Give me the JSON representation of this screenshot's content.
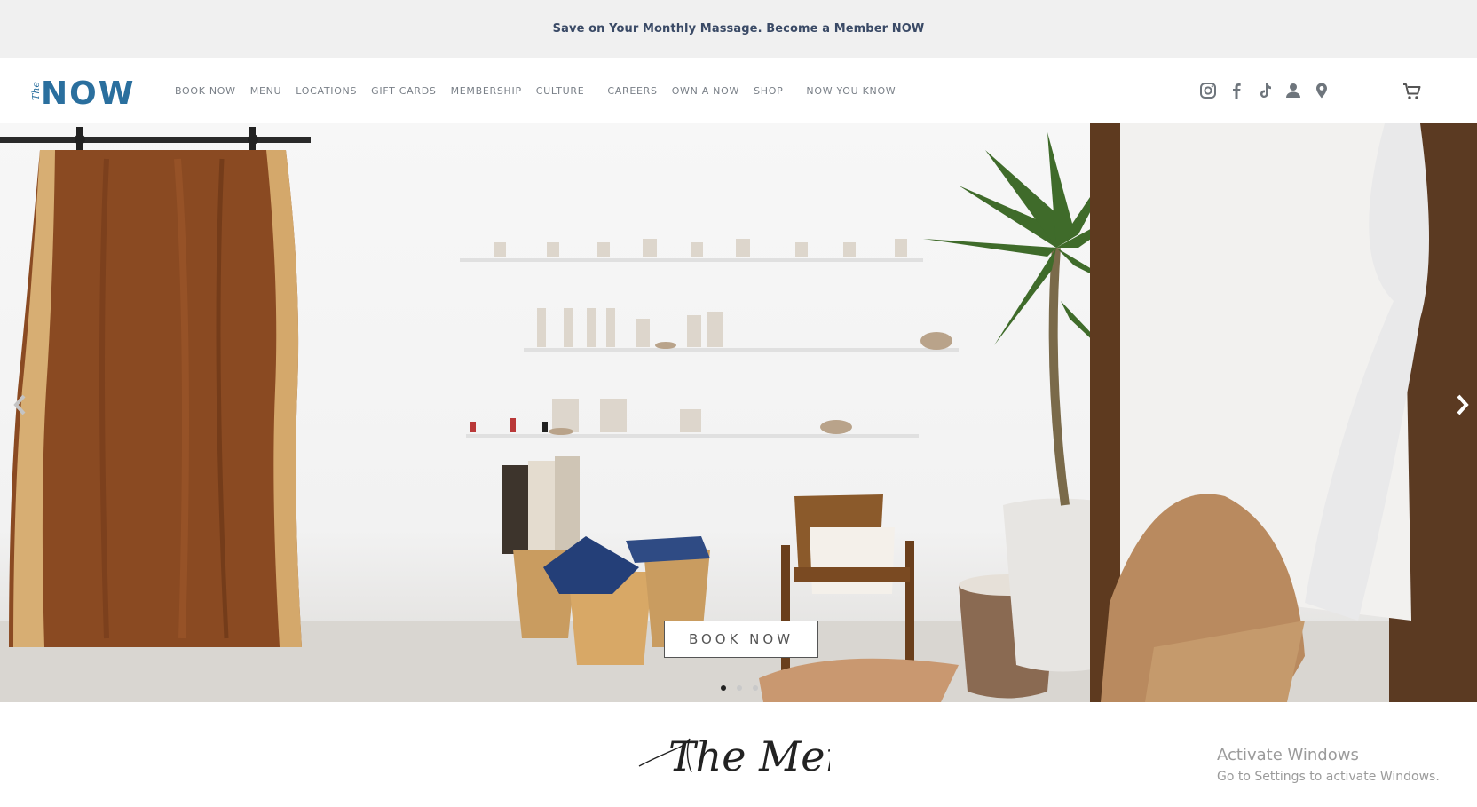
{
  "announcement": {
    "text": "Save on Your Monthly Massage. Become a Member NOW"
  },
  "header": {
    "logo_small": "The",
    "logo_big": "NOW",
    "nav": [
      {
        "label": "BOOK NOW"
      },
      {
        "label": "MENU"
      },
      {
        "label": "LOCATIONS"
      },
      {
        "label": "GIFT CARDS"
      },
      {
        "label": "MEMBERSHIP"
      },
      {
        "label": "CULTURE"
      },
      {
        "label": "CAREERS"
      },
      {
        "label": "OWN A NOW"
      },
      {
        "label": "SHOP"
      },
      {
        "label": "NOW YOU KNOW"
      }
    ],
    "social_icons": [
      "instagram-icon",
      "facebook-icon",
      "tiktok-icon",
      "account-icon",
      "location-pin-icon"
    ],
    "cart": {
      "icon": "cart-icon",
      "count": "0"
    }
  },
  "hero": {
    "cta_label": "BOOK NOW",
    "slides_total": 3,
    "active_slide": 1,
    "prev_icon": "chevron-left-icon",
    "next_icon": "chevron-right-icon"
  },
  "section": {
    "heading": "The Menu"
  },
  "os_watermark": {
    "title": "Activate Windows",
    "subtitle": "Go to Settings to activate Windows."
  },
  "colors": {
    "brand_navy": "#2f3d5c",
    "logo_blue": "#2a6f9e",
    "nav_text": "#7a8088"
  }
}
